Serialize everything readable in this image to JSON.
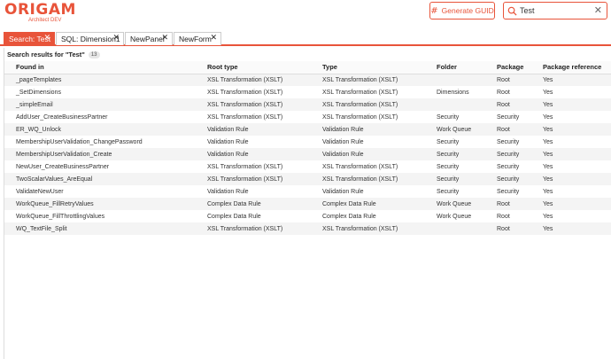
{
  "app": {
    "logo_text": "ORIGAM",
    "logo_sub": "Architect DEV"
  },
  "toolbar": {
    "generate_guid_label": "Generate GUID"
  },
  "search": {
    "value": "Test"
  },
  "tabs": [
    {
      "label": "Search: Test",
      "active": true
    },
    {
      "label": "SQL: Dimension1",
      "active": false
    },
    {
      "label": "NewPanel",
      "active": false
    },
    {
      "label": "NewForm",
      "active": false
    }
  ],
  "results": {
    "heading": "Search results for \"Test\"",
    "count": "13",
    "columns": [
      "Found in",
      "Root type",
      "Type",
      "Folder",
      "Package",
      "Package reference"
    ],
    "rows": [
      [
        "_pageTemplates",
        "XSL Transformation (XSLT)",
        "XSL Transformation (XSLT)",
        "",
        "Root",
        "Yes"
      ],
      [
        "_SetDimensions",
        "XSL Transformation (XSLT)",
        "XSL Transformation (XSLT)",
        "Dimensions",
        "Root",
        "Yes"
      ],
      [
        "_simpleEmail",
        "XSL Transformation (XSLT)",
        "XSL Transformation (XSLT)",
        "",
        "Root",
        "Yes"
      ],
      [
        "AddUser_CreateBusinessPartner",
        "XSL Transformation (XSLT)",
        "XSL Transformation (XSLT)",
        "Security",
        "Security",
        "Yes"
      ],
      [
        "ER_WQ_Unlock",
        "Validation Rule",
        "Validation Rule",
        "Work Queue",
        "Root",
        "Yes"
      ],
      [
        "MembershipUserValidation_ChangePassword",
        "Validation Rule",
        "Validation Rule",
        "Security",
        "Security",
        "Yes"
      ],
      [
        "MembershipUserValidation_Create",
        "Validation Rule",
        "Validation Rule",
        "Security",
        "Security",
        "Yes"
      ],
      [
        "NewUser_CreateBusinessPartner",
        "XSL Transformation (XSLT)",
        "XSL Transformation (XSLT)",
        "Security",
        "Security",
        "Yes"
      ],
      [
        "TwoScalarValues_AreEqual",
        "XSL Transformation (XSLT)",
        "XSL Transformation (XSLT)",
        "Security",
        "Security",
        "Yes"
      ],
      [
        "ValidateNewUser",
        "Validation Rule",
        "Validation Rule",
        "Security",
        "Security",
        "Yes"
      ],
      [
        "WorkQueue_FillRetryValues",
        "Complex Data Rule",
        "Complex Data Rule",
        "Work Queue",
        "Root",
        "Yes"
      ],
      [
        "WorkQueue_FillThrottlingValues",
        "Complex Data Rule",
        "Complex Data Rule",
        "Work Queue",
        "Root",
        "Yes"
      ],
      [
        "WQ_TextFile_Split",
        "XSL Transformation (XSLT)",
        "XSL Transformation (XSLT)",
        "",
        "Root",
        "Yes"
      ]
    ]
  },
  "icons": {
    "generate": "hash-icon",
    "search": "search-icon",
    "clear": "close-icon",
    "tab_close": "close-icon"
  },
  "colors": {
    "accent": "#e8543a",
    "row_stripe": "#f4f4f4"
  }
}
